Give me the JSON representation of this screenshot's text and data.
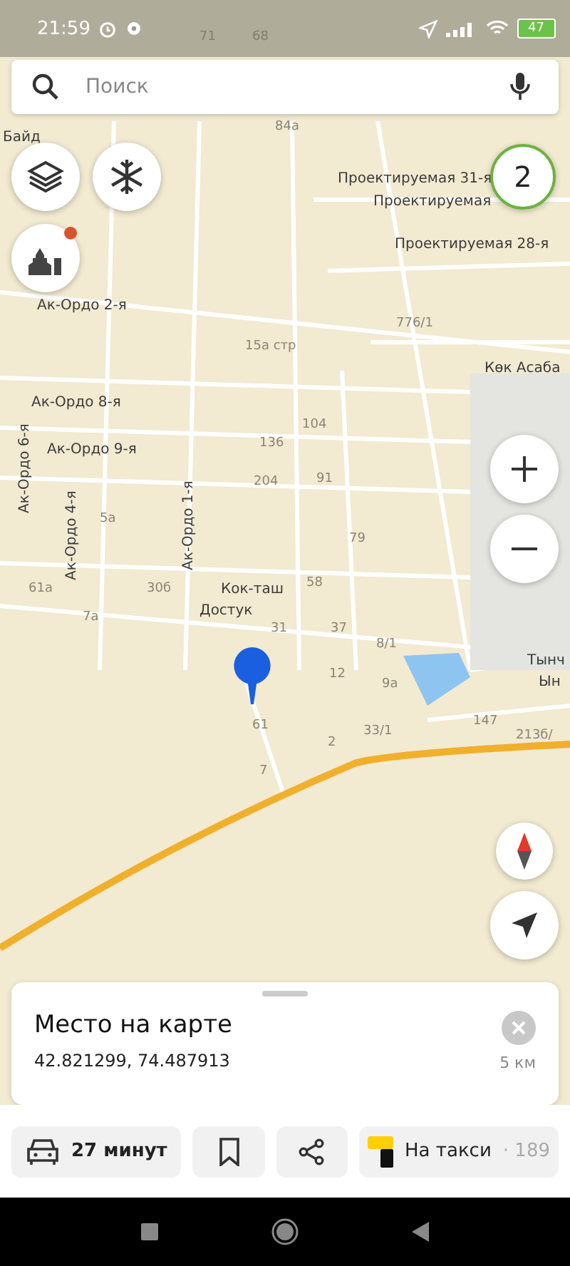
{
  "status_bar": {
    "time": "21:59",
    "battery": "47"
  },
  "search": {
    "placeholder": "Поиск"
  },
  "cluster_badge": "2",
  "map_labels": [
    {
      "kind": "house",
      "text": "71"
    },
    {
      "kind": "house",
      "text": "68"
    },
    {
      "kind": "house",
      "text": "84а"
    },
    {
      "kind": "street",
      "text": "Байд"
    },
    {
      "kind": "street",
      "text": "Проектируемая 31-я"
    },
    {
      "kind": "street",
      "text": "Проектируемая"
    },
    {
      "kind": "street",
      "text": "Проектируемая 28-я"
    },
    {
      "kind": "house",
      "text": "776/1"
    },
    {
      "kind": "street",
      "text": "Көк Асаба"
    },
    {
      "kind": "street",
      "text": "Ак-Ордо 2-я"
    },
    {
      "kind": "house",
      "text": "15а стр"
    },
    {
      "kind": "street",
      "text": "Ак-Ордо 8-я"
    },
    {
      "kind": "house",
      "text": "104"
    },
    {
      "kind": "street",
      "text": "Ак-Ордо 9-я"
    },
    {
      "kind": "house",
      "text": "136"
    },
    {
      "kind": "house",
      "text": "204"
    },
    {
      "kind": "house",
      "text": "91"
    },
    {
      "kind": "house",
      "text": "79"
    },
    {
      "kind": "vertical",
      "text": "Ак-Ордо 6-я"
    },
    {
      "kind": "vertical",
      "text": "Ак-Ордо 4-я"
    },
    {
      "kind": "vertical",
      "text": "Ак-Ордо 1-я"
    },
    {
      "kind": "house",
      "text": "5а"
    },
    {
      "kind": "house",
      "text": "61а"
    },
    {
      "kind": "house",
      "text": "30б"
    },
    {
      "kind": "street",
      "text": "Кок-таш"
    },
    {
      "kind": "house",
      "text": "58"
    },
    {
      "kind": "house",
      "text": "7а"
    },
    {
      "kind": "street",
      "text": "Достук"
    },
    {
      "kind": "house",
      "text": "31"
    },
    {
      "kind": "house",
      "text": "37"
    },
    {
      "kind": "house",
      "text": "8/1"
    },
    {
      "kind": "house",
      "text": "12"
    },
    {
      "kind": "house",
      "text": "9а"
    },
    {
      "kind": "house",
      "text": "61"
    },
    {
      "kind": "house",
      "text": "2"
    },
    {
      "kind": "house",
      "text": "33/1"
    },
    {
      "kind": "house",
      "text": "7"
    },
    {
      "kind": "house",
      "text": "147"
    },
    {
      "kind": "house",
      "text": "213б/"
    },
    {
      "kind": "street",
      "text": "Тынч"
    },
    {
      "kind": "street",
      "text": "Ын"
    }
  ],
  "place_card": {
    "title": "Место на карте",
    "coordinates": "42.821299, 74.487913",
    "distance": "5 км"
  },
  "actions": [
    {
      "kind": "route",
      "label": "27 минут"
    },
    {
      "kind": "bookmark"
    },
    {
      "kind": "share"
    },
    {
      "kind": "taxi",
      "label": "На такси",
      "price": "· 189"
    }
  ]
}
